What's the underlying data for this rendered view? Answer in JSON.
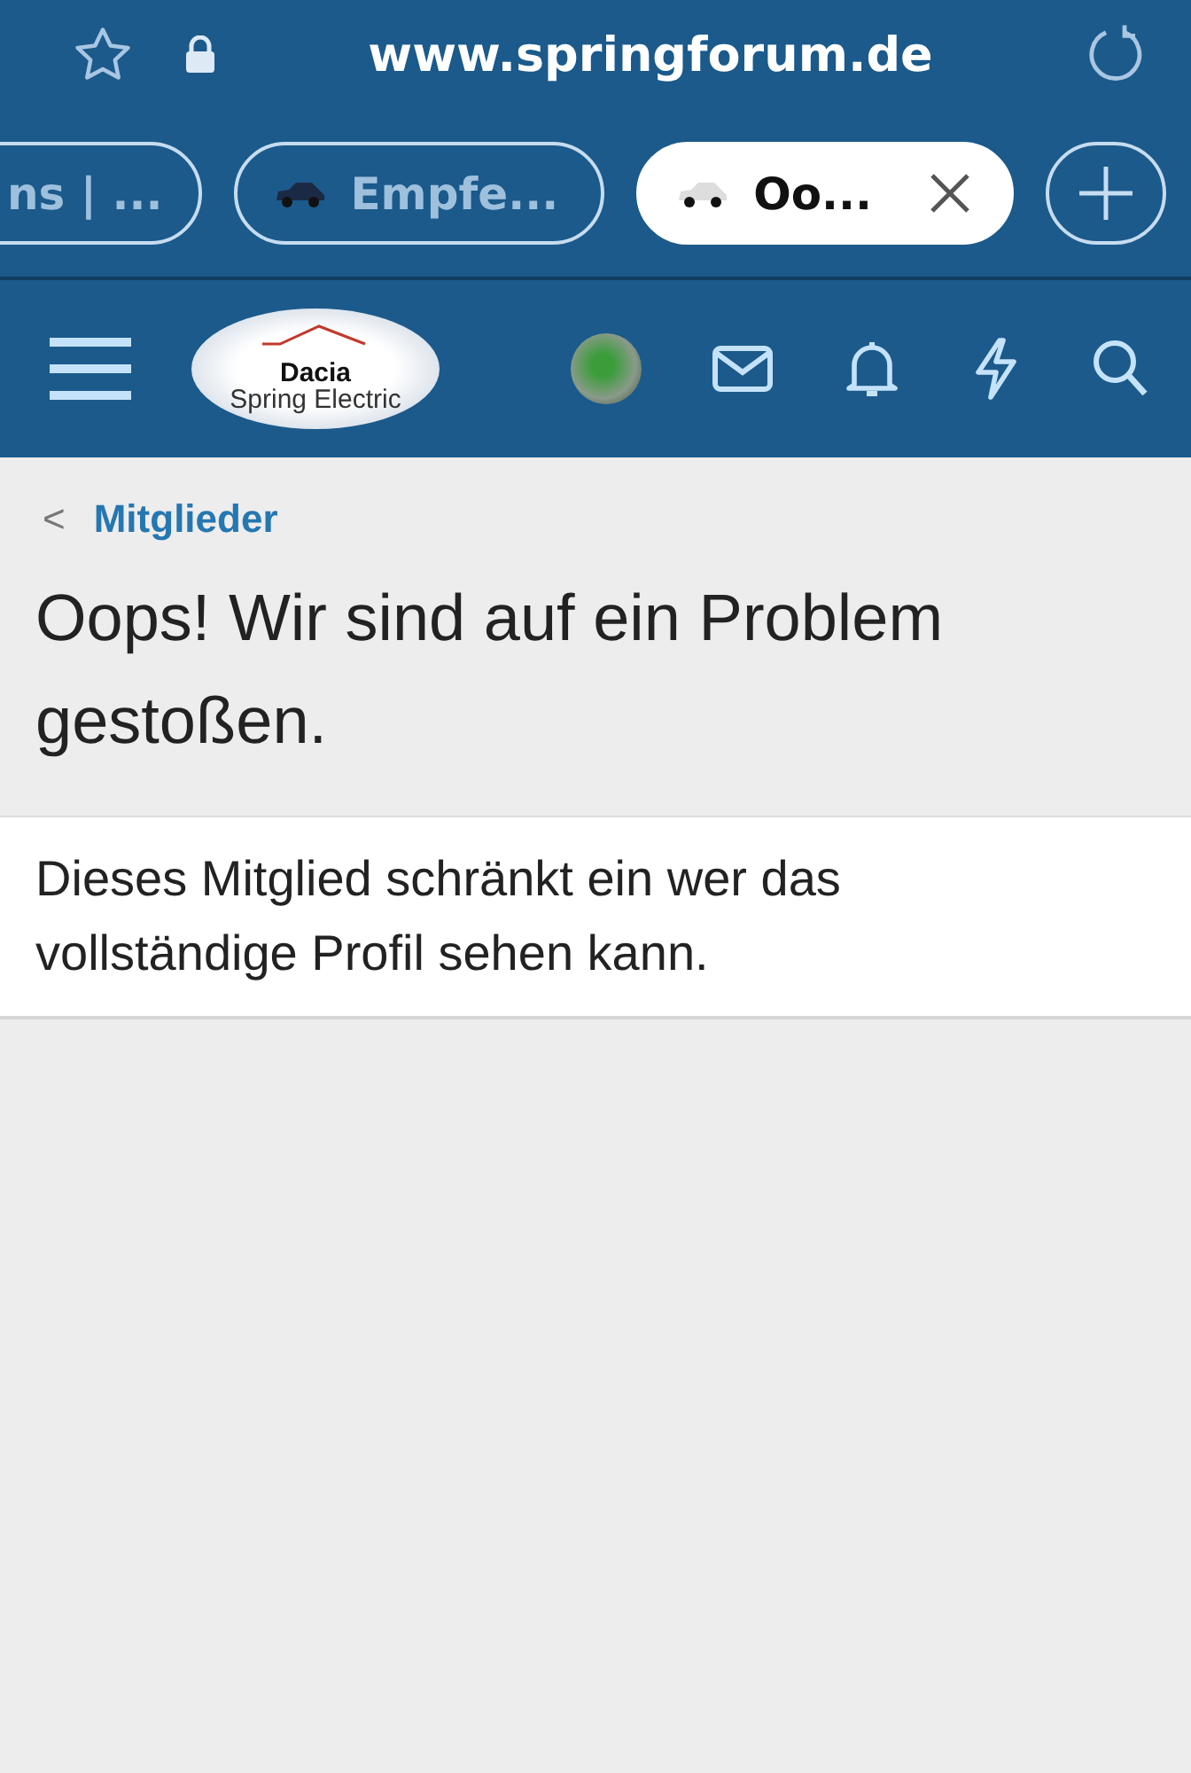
{
  "browser": {
    "url": "www.springforum.de",
    "tabs": [
      {
        "label": "ns | ...",
        "selected": false,
        "icon": false
      },
      {
        "label": "Empfe...",
        "selected": false,
        "icon": true
      },
      {
        "label": "Oo...",
        "selected": true,
        "icon": true
      }
    ]
  },
  "header": {
    "logo": {
      "line_1": "Dacia",
      "line_2": "Spring Electric"
    }
  },
  "breadcrumb": {
    "back": "<",
    "label": "Mitglieder"
  },
  "title": "Oops! Wir sind auf ein Problem gestoßen.",
  "message": "Dieses Mitglied schränkt ein wer das vollständige Profil sehen kann."
}
